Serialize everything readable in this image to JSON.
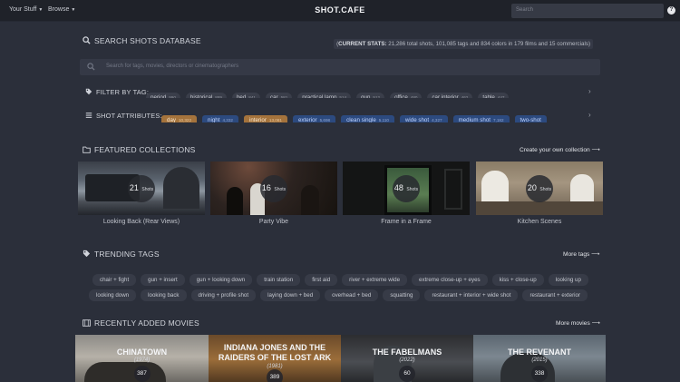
{
  "nav": {
    "your_stuff": "Your Stuff",
    "browse": "Browse",
    "logo": "SHOT.CAFE",
    "search_placeholder": "Search"
  },
  "db": {
    "title": "SEARCH SHOTS DATABASE",
    "stats": {
      "prefix": "CURRENT STATS:",
      "shots": "21,286",
      "shots_label": "total shots,",
      "tags": "101,085",
      "tags_label": "tags and",
      "colors": "834",
      "colors_label": "colors in",
      "films": "179 films",
      "and": "and",
      "commercials": "15 commercials"
    },
    "search_placeholder": "Search for tags, movies, directors or cinematographers"
  },
  "filter": {
    "label": "FILTER BY TAG:",
    "tags": [
      {
        "name": "period",
        "count": "990"
      },
      {
        "name": "historical",
        "count": "889"
      },
      {
        "name": "bed",
        "count": "841"
      },
      {
        "name": "car",
        "count": "581"
      },
      {
        "name": "practical lamp",
        "count": "514"
      },
      {
        "name": "gun",
        "count": "512"
      },
      {
        "name": "office",
        "count": "480"
      },
      {
        "name": "car interior",
        "count": "462"
      },
      {
        "name": "table",
        "count": "447"
      }
    ]
  },
  "attributes": {
    "label": "SHOT ATTRIBUTES:",
    "items": [
      {
        "name": "day",
        "count": "10,322",
        "color": "orange"
      },
      {
        "name": "night",
        "count": "4,332",
        "color": "blue"
      },
      {
        "name": "interior",
        "count": "13,081",
        "color": "orange"
      },
      {
        "name": "exterior",
        "count": "5,698",
        "color": "blue"
      },
      {
        "name": "clean single",
        "count": "5,110",
        "color": "blue"
      },
      {
        "name": "wide shot",
        "count": "4,327",
        "color": "blue"
      },
      {
        "name": "medium shot",
        "count": "7,182",
        "color": "blue"
      },
      {
        "name": "two-shot",
        "count": "",
        "color": "blue"
      }
    ]
  },
  "collections": {
    "title": "FEATURED COLLECTIONS",
    "create_link": "Create your own collection",
    "shots_label": "Shots",
    "items": [
      {
        "count": "21",
        "name": "Looking Back (Rear Views)"
      },
      {
        "count": "16",
        "name": "Party Vibe"
      },
      {
        "count": "48",
        "name": "Frame in a Frame"
      },
      {
        "count": "20",
        "name": "Kitchen Scenes"
      }
    ]
  },
  "trending": {
    "title": "TRENDING TAGS",
    "more_link": "More tags",
    "row1": [
      "chair + fight",
      "gun + insert",
      "gun + looking down",
      "train station",
      "first aid",
      "river + extreme wide",
      "extreme close-up + eyes",
      "kiss + close-up",
      "looking up"
    ],
    "row2": [
      "looking down",
      "looking back",
      "driving + profile shot",
      "laying down + bed",
      "overhead + bed",
      "squatting",
      "restaurant + interior + wide shot",
      "restaurant + exterior"
    ]
  },
  "movies": {
    "title": "RECENTLY ADDED MOVIES",
    "more_link": "More movies",
    "items": [
      {
        "title": "CHINATOWN",
        "year": "(1974)",
        "count": "387"
      },
      {
        "title": "INDIANA JONES AND THE RAIDERS OF THE LOST ARK",
        "year": "(1981)",
        "count": "389"
      },
      {
        "title": "THE FABELMANS",
        "year": "(2022)",
        "count": "60"
      },
      {
        "title": "THE REVENANT",
        "year": "(2015)",
        "count": "338"
      }
    ]
  },
  "colors": {
    "background": "#2b2f3a",
    "topbar": "#1f2229",
    "attr_blue": "#2c4a7f",
    "attr_orange": "#a4733c"
  }
}
